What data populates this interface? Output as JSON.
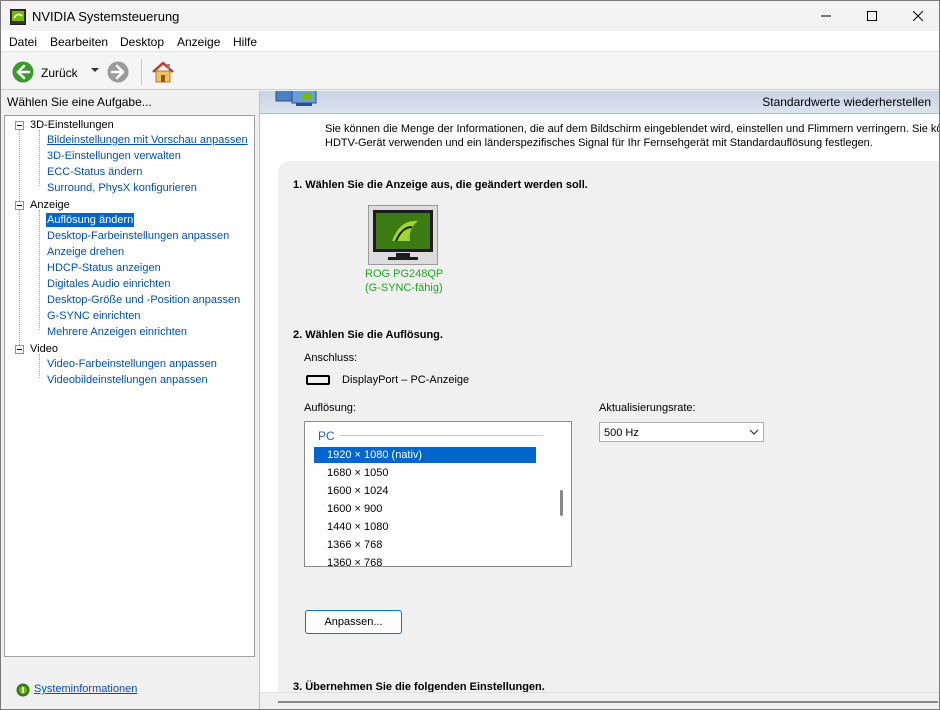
{
  "window": {
    "title": "NVIDIA Systemsteuerung"
  },
  "menu": [
    "Datei",
    "Bearbeiten",
    "Desktop",
    "Anzeige",
    "Hilfe"
  ],
  "toolbar": {
    "back_label": "Zurück"
  },
  "sidebar": {
    "task_header": "Wählen Sie eine Aufgabe...",
    "groups": [
      {
        "label": "3D-Einstellungen",
        "items": [
          "Bildeinstellungen mit Vorschau anpassen",
          "3D-Einstellungen verwalten",
          "ECC-Status ändern",
          "Surround, PhysX konfigurieren"
        ]
      },
      {
        "label": "Anzeige",
        "items": [
          "Auflösung ändern",
          "Desktop-Farbeinstellungen anpassen",
          "Anzeige drehen",
          "HDCP-Status anzeigen",
          "Digitales Audio einrichten",
          "Desktop-Größe und -Position anpassen",
          "G-SYNC einrichten",
          "Mehrere Anzeigen einrichten"
        ]
      },
      {
        "label": "Video",
        "items": [
          "Video-Farbeinstellungen anpassen",
          "Videobildeinstellungen anpassen"
        ]
      }
    ],
    "selected_item": "Auflösung ändern",
    "system_info": "Systeminformationen"
  },
  "main": {
    "restore_defaults": "Standardwerte wiederherstellen",
    "description_line1": "Sie können die Menge der Informationen, die auf dem Bildschirm eingeblendet wird, einstellen und Flimmern verringern. Sie können",
    "description_line2": "HDTV-Gerät verwenden und ein länderspezifisches Signal für Ihr Fernsehgerät mit Standardauflösung festlegen.",
    "step1_title": "1. Wählen Sie die Anzeige aus, die geändert werden soll.",
    "monitor_name": "ROG PG248QP",
    "monitor_sub": "(G-SYNC-fähig)",
    "step2_title": "2. Wählen Sie die Auflösung.",
    "connection_label": "Anschluss:",
    "connection_value": "DisplayPort – PC-Anzeige",
    "resolution_label": "Auflösung:",
    "resolution_group": "PC",
    "resolutions": [
      "1920 × 1080 (nativ)",
      "1680 × 1050",
      "1600 × 1024",
      "1600 × 900",
      "1440 × 1080",
      "1366 × 768",
      "1360 × 768"
    ],
    "selected_resolution_index": 0,
    "refresh_label": "Aktualisierungsrate:",
    "refresh_value": "500 Hz",
    "customize_button": "Anpassen...",
    "step3_title": "3. Übernehmen Sie die folgenden Einstellungen."
  },
  "colors": {
    "selection": "#0066cc",
    "link": "#0050b4",
    "monitor_label": "#1aa81a",
    "nvidia_green": "#76b900"
  }
}
